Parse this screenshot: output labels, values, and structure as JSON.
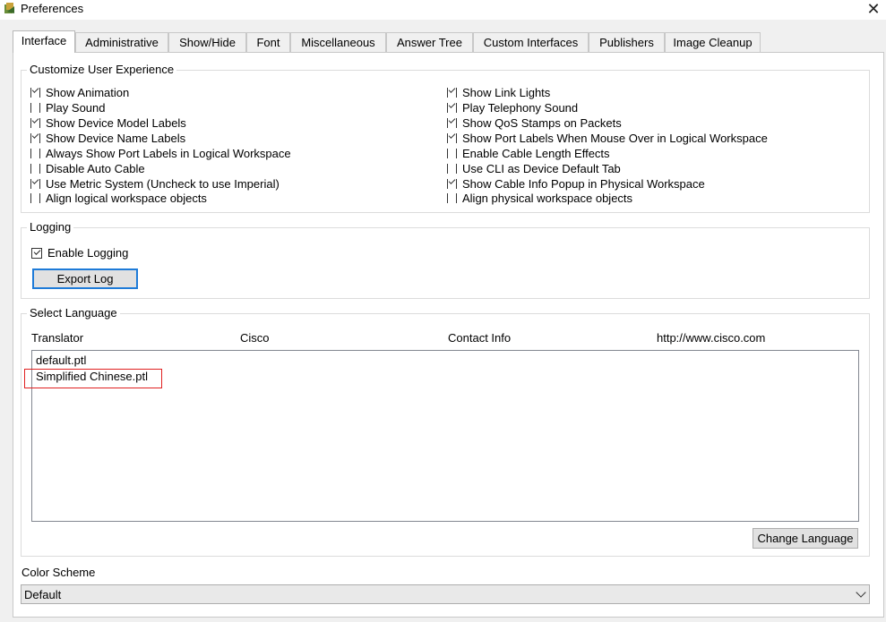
{
  "window": {
    "title": "Preferences",
    "close_glyph": "✕",
    "icon": "app-icon"
  },
  "tabs": [
    {
      "label": "Interface",
      "active": true
    },
    {
      "label": "Administrative"
    },
    {
      "label": "Show/Hide"
    },
    {
      "label": "Font"
    },
    {
      "label": "Miscellaneous"
    },
    {
      "label": "Answer Tree"
    },
    {
      "label": "Custom Interfaces"
    },
    {
      "label": "Publishers"
    },
    {
      "label": "Image Cleanup"
    }
  ],
  "experience": {
    "legend": "Customize User Experience",
    "left": [
      {
        "label": "Show Animation",
        "checked": true
      },
      {
        "label": "Play Sound",
        "checked": false
      },
      {
        "label": "Show Device Model Labels",
        "checked": true
      },
      {
        "label": "Show Device Name Labels",
        "checked": true
      },
      {
        "label": "Always Show Port Labels in Logical Workspace",
        "checked": false
      },
      {
        "label": "Disable Auto Cable",
        "checked": false
      },
      {
        "label": "Use Metric System (Uncheck to use Imperial)",
        "checked": true
      },
      {
        "label": "Align logical workspace objects",
        "checked": false
      }
    ],
    "right": [
      {
        "label": "Show Link Lights",
        "checked": true
      },
      {
        "label": "Play Telephony Sound",
        "checked": true
      },
      {
        "label": "Show QoS Stamps on Packets",
        "checked": true
      },
      {
        "label": "Show Port Labels When Mouse Over in Logical Workspace",
        "checked": true
      },
      {
        "label": "Enable Cable Length Effects",
        "checked": false
      },
      {
        "label": "Use CLI as Device Default Tab",
        "checked": false
      },
      {
        "label": "Show Cable Info Popup in Physical Workspace",
        "checked": true
      },
      {
        "label": "Align physical workspace objects",
        "checked": false
      }
    ]
  },
  "logging": {
    "legend": "Logging",
    "enable_label": "Enable Logging",
    "enable_checked": true,
    "export_button": "Export Log"
  },
  "language": {
    "legend": "Select Language",
    "columns": [
      "Translator",
      "Cisco",
      "Contact Info",
      "http://www.cisco.com"
    ],
    "items": [
      "default.ptl",
      "Simplified Chinese.ptl"
    ],
    "highlighted_index": 1,
    "change_button": "Change Language"
  },
  "color_scheme": {
    "label": "Color Scheme",
    "value": "Default"
  },
  "colors": {
    "highlight_box": "#e02020",
    "default_button_border": "#1e7bd8"
  }
}
